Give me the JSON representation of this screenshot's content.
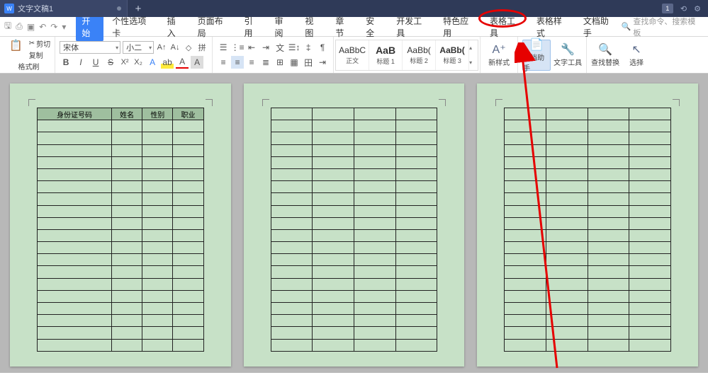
{
  "titlebar": {
    "doc_name": "文字文稿1",
    "notif_count": "1"
  },
  "menus": {
    "start": "开始",
    "custom_tab": "个性选项卡",
    "insert": "插入",
    "page_layout": "页面布局",
    "reference": "引用",
    "review": "审阅",
    "view": "视图",
    "chapter": "章节",
    "security": "安全",
    "dev_tools": "开发工具",
    "special": "特色应用",
    "table_tools": "表格工具",
    "table_style": "表格样式",
    "doc_assistant": "文档助手"
  },
  "search_placeholder": "查找命令、搜索模板",
  "ribbon": {
    "cut": "剪切",
    "copy": "复制",
    "format_painter": "格式刷",
    "font_name": "宋体",
    "font_size": "小二",
    "styles": {
      "s1": {
        "preview": "AaBbC",
        "label": "正文"
      },
      "s2": {
        "preview": "AaB",
        "label": "标题 1"
      },
      "s3": {
        "preview": "AaBb(",
        "label": "标题 2"
      },
      "s4": {
        "preview": "AaBb(",
        "label": "标题 3"
      }
    },
    "new_style": "新样式",
    "doc_assistant": "文档助手",
    "text_tools": "文字工具",
    "find_replace": "查找替换",
    "select": "选择"
  },
  "table_headers": [
    "身份证号码",
    "姓名",
    "性别",
    "职业"
  ]
}
